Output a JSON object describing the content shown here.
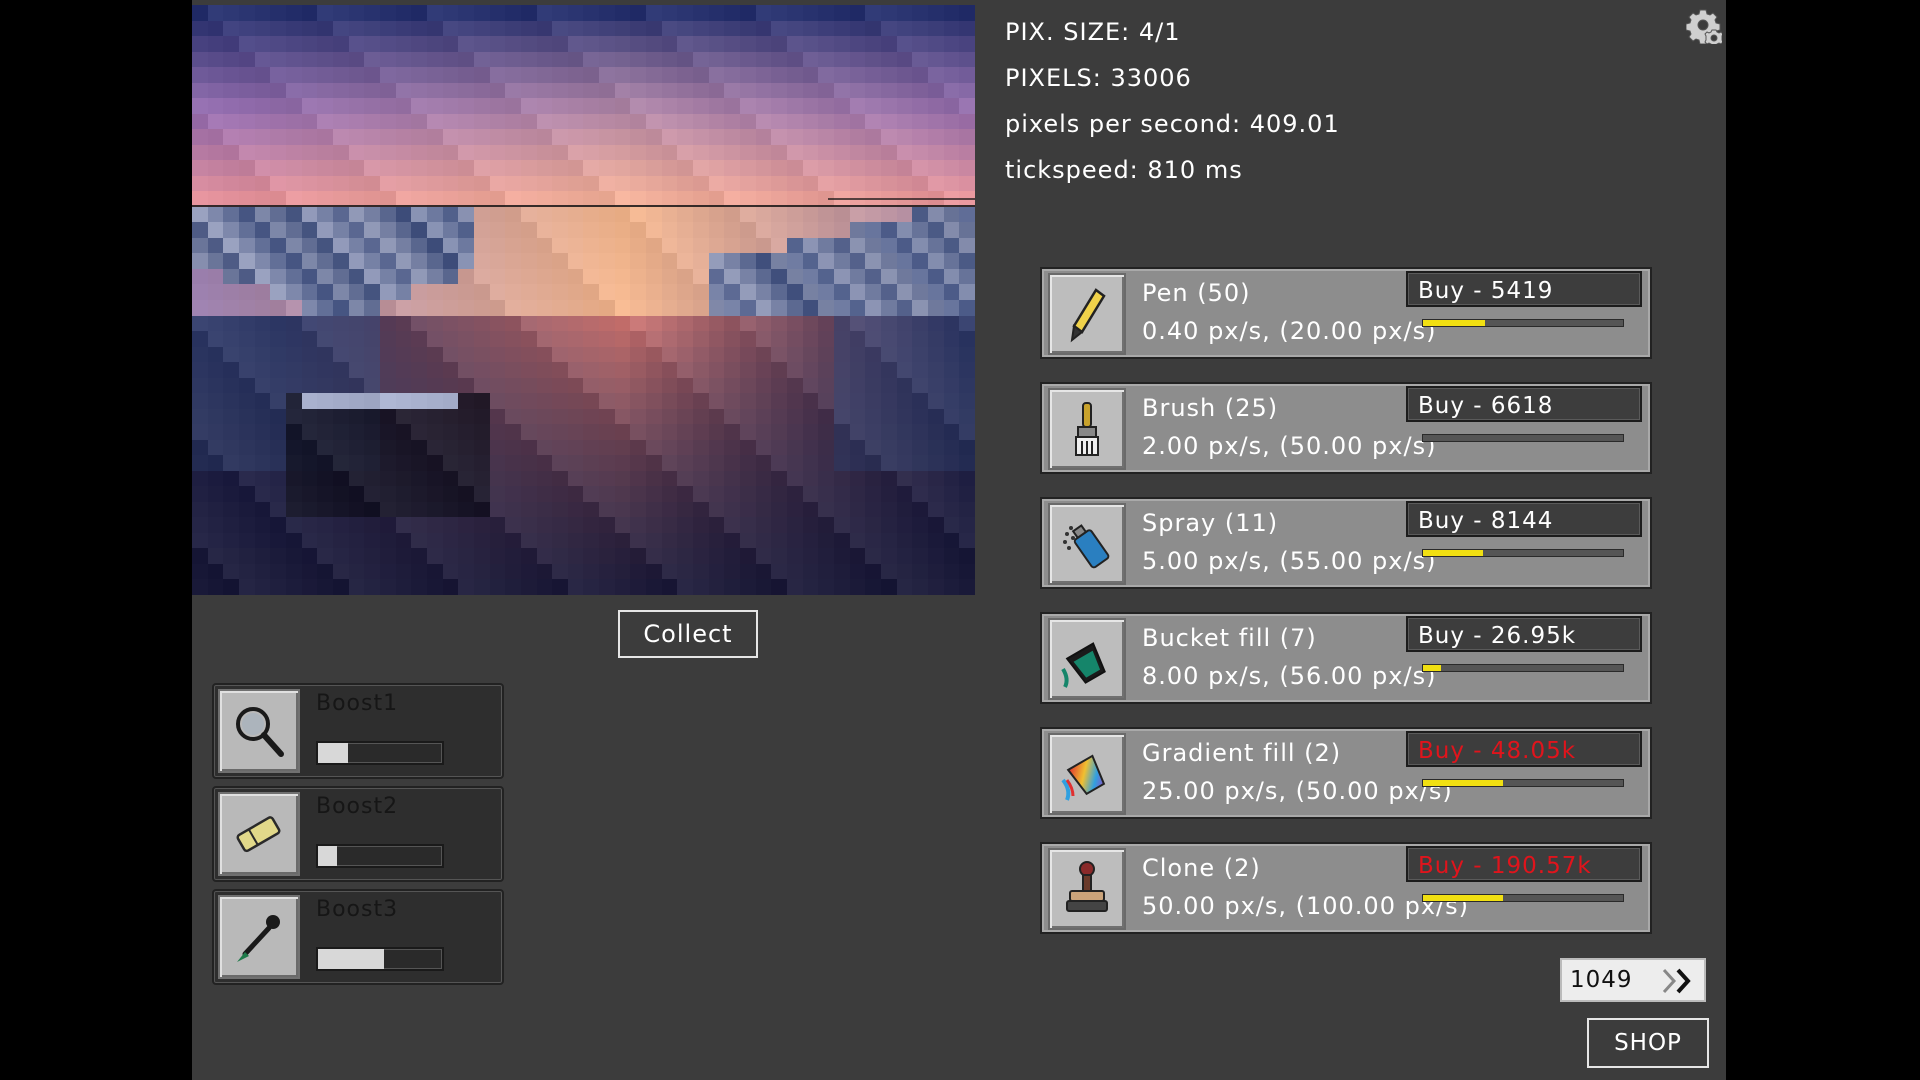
{
  "stats": {
    "pix_size": "PIX. SIZE: 4/1",
    "pixels": "PIXELS: 33006",
    "pps": "pixels per second: 409.01",
    "tickspeed": "tickspeed: 810 ms"
  },
  "collect_label": "Collect",
  "boosts": [
    {
      "name": "Boost1",
      "icon": "magnifier-icon",
      "progress": 0.24
    },
    {
      "name": "Boost2",
      "icon": "eraser-icon",
      "progress": 0.15
    },
    {
      "name": "Boost3",
      "icon": "eyedropper-icon",
      "progress": 0.53
    }
  ],
  "tools": [
    {
      "name": "Pen (50)",
      "rate": "0.40 px/s, (20.00 px/s)",
      "buy": "Buy - 5419",
      "affordable": true,
      "progress": 0.31,
      "icon": "pen-icon"
    },
    {
      "name": "Brush (25)",
      "rate": "2.00 px/s, (50.00 px/s)",
      "buy": "Buy - 6618",
      "affordable": true,
      "progress": 0.0,
      "icon": "brush-icon"
    },
    {
      "name": "Spray (11)",
      "rate": "5.00 px/s, (55.00 px/s)",
      "buy": "Buy - 8144",
      "affordable": true,
      "progress": 0.3,
      "icon": "spray-can-icon"
    },
    {
      "name": "Bucket fill (7)",
      "rate": "8.00 px/s, (56.00 px/s)",
      "buy": "Buy - 26.95k",
      "affordable": true,
      "progress": 0.09,
      "icon": "paint-bucket-icon"
    },
    {
      "name": "Gradient fill (2)",
      "rate": "25.00 px/s, (50.00 px/s)",
      "buy": "Buy - 48.05k",
      "affordable": false,
      "progress": 0.4,
      "icon": "gradient-fill-icon"
    },
    {
      "name": "Clone (2)",
      "rate": "50.00 px/s, (100.00 px/s)",
      "buy": "Buy - 190.57k",
      "affordable": false,
      "progress": 0.4,
      "icon": "clone-stamp-icon"
    }
  ],
  "counter": "1049",
  "shop_label": "SHOP",
  "colors": {
    "affordable": "#ffffff",
    "unaffordable": "#e0141c",
    "progress": "#f1e012"
  }
}
